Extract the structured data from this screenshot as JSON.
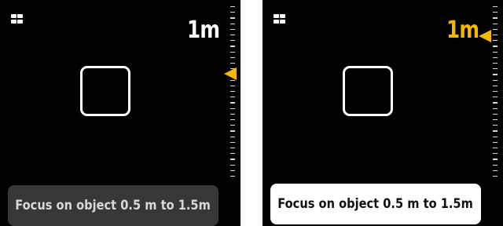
{
  "screens": [
    {
      "state": "inactive",
      "distance_label": "1m",
      "distance_color": "#ffffff",
      "hint_text": "Focus on object 0.5 m to 1.5m",
      "hint_background": "#373737",
      "pointer_color": "#f5b800",
      "grid_icon": "grid-icon",
      "pointer_icon": "triangle-left-icon"
    },
    {
      "state": "active",
      "distance_label": "1m",
      "distance_color": "#f5b800",
      "hint_text": "Focus on object 0.5 m to 1.5m",
      "hint_background": "#ffffff",
      "pointer_color": "#f5b800",
      "grid_icon": "grid-icon",
      "pointer_icon": "triangle-left-icon"
    }
  ]
}
